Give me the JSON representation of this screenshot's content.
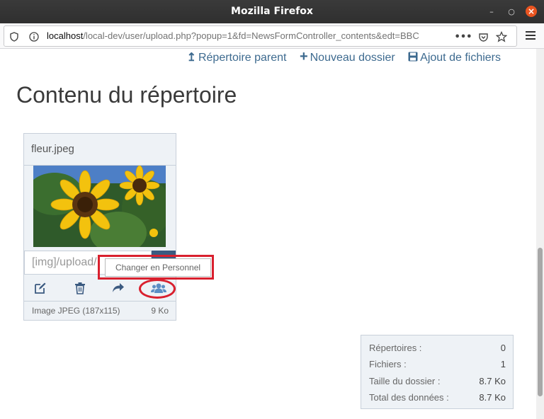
{
  "window": {
    "title": "Mozilla Firefox"
  },
  "urlbar": {
    "host": "localhost",
    "path": "/local-dev/user/upload.php?popup=1&fd=NewsFormController_contents&edt=BBC"
  },
  "toolbar": {
    "parent_dir": "Répertoire parent",
    "new_folder": "Nouveau dossier",
    "add_files": "Ajout de fichiers"
  },
  "page": {
    "heading": "Contenu du répertoire"
  },
  "file_card": {
    "name": "fleur.jpeg",
    "path_value": "[img]/upload/",
    "type_label": "Image JPEG (187x115)",
    "size": "9 Ko",
    "actions": [
      "edit-icon",
      "trash-icon",
      "share-icon",
      "users-icon"
    ]
  },
  "tooltip": {
    "text": "Changer en Personnel"
  },
  "stats": {
    "rows": [
      {
        "label": "Répertoires :",
        "value": "0"
      },
      {
        "label": "Fichiers :",
        "value": "1"
      },
      {
        "label": "Taille du dossier :",
        "value": "8.7 Ko"
      },
      {
        "label": "Total des données :",
        "value": "8.7 Ko"
      }
    ]
  },
  "colors": {
    "accent": "#3d6a8f",
    "highlight": "#d9202e",
    "card_bg": "#eef2f6"
  }
}
